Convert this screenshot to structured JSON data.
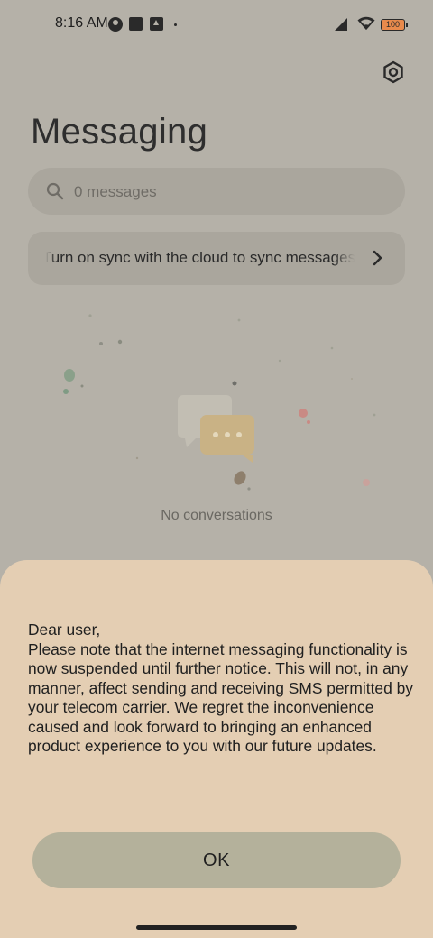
{
  "status_bar": {
    "time": "8:16 AM",
    "battery": "100",
    "icons": [
      "circle-app-icon",
      "square-app-icon",
      "upload-app-icon",
      "notification-dot-icon",
      "signal-icon",
      "wifi-icon",
      "battery-icon"
    ]
  },
  "header": {
    "title": "Messaging",
    "settings_icon": "hexagon-settings-icon"
  },
  "search": {
    "placeholder": "0 messages",
    "icon": "search-icon"
  },
  "sync_banner": {
    "text": "Turn on sync with the cloud to sync messages",
    "icon": "chevron-right-icon"
  },
  "empty_state": {
    "text": "No conversations",
    "icon": "chat-bubbles-icon"
  },
  "dialog": {
    "lines": [
      "Dear user,",
      "Please note that the internet messaging functionality is now suspended until further notice. This will not, in any manner, affect sending and receiving SMS permitted by your telecom carrier. We regret the inconvenience caused and look forward to bringing an enhanced product experience to you with our future updates."
    ],
    "ok_label": "OK"
  },
  "colors": {
    "background_dimmed": "#b5b1a8",
    "dialog_background": "#e4ceb3",
    "ok_button": "#b4b19b",
    "battery_fill": "#e88a4c"
  }
}
